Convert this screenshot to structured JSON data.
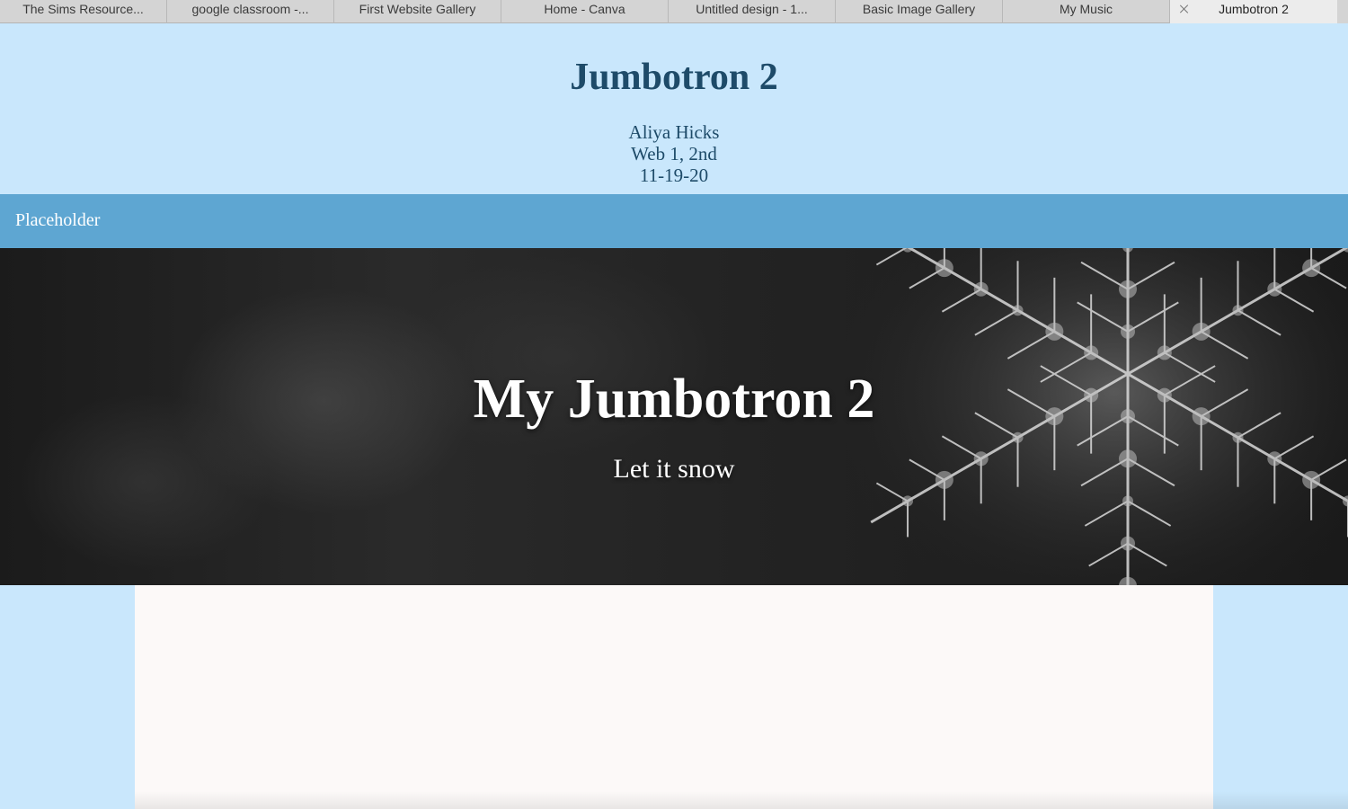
{
  "browser": {
    "tabs": [
      {
        "label": "The Sims Resource..."
      },
      {
        "label": "google classroom -..."
      },
      {
        "label": "First Website Gallery"
      },
      {
        "label": "Home - Canva"
      },
      {
        "label": "Untitled design - 1..."
      },
      {
        "label": "Basic Image Gallery"
      },
      {
        "label": "My Music"
      },
      {
        "label": "Jumbotron 2",
        "active": true
      }
    ]
  },
  "header": {
    "title": "Jumbotron 2",
    "author": "Aliya Hicks",
    "class_period": "Web 1, 2nd",
    "date": "11-19-20"
  },
  "nav": {
    "link_label": "Placeholder"
  },
  "jumbotron": {
    "title": "My Jumbotron 2",
    "subtitle": "Let it snow",
    "background_image": "snowflake-photo"
  },
  "colors": {
    "page_background": "#c9e7fc",
    "header_text": "#1e4b69",
    "nav_background": "#5ea6d2",
    "content_background": "#fcf9f8"
  }
}
